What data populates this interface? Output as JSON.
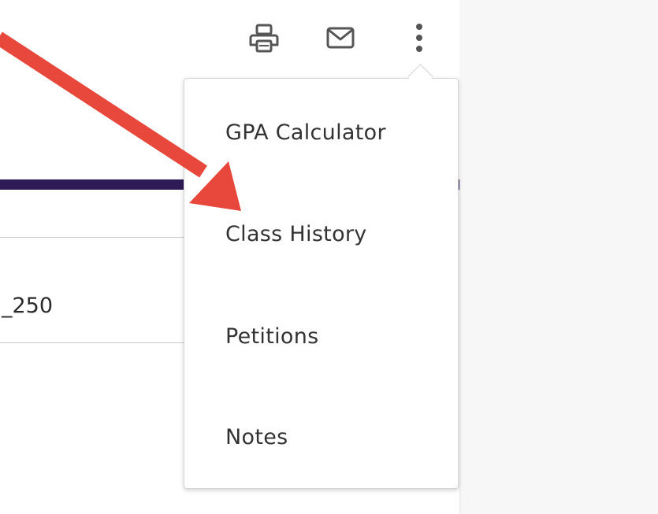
{
  "toolbar": {
    "print_icon": "printer-icon",
    "mail_icon": "envelope-icon",
    "more_icon": "vertical-ellipsis-icon"
  },
  "content": {
    "row_value": "_250"
  },
  "menu": {
    "items": [
      {
        "label": "GPA Calculator"
      },
      {
        "label": "Class History"
      },
      {
        "label": "Petitions"
      },
      {
        "label": "Notes"
      }
    ]
  },
  "colors": {
    "accent_bar": "#2e1a55",
    "annotation_arrow": "#e8473b",
    "icon": "#555555"
  }
}
